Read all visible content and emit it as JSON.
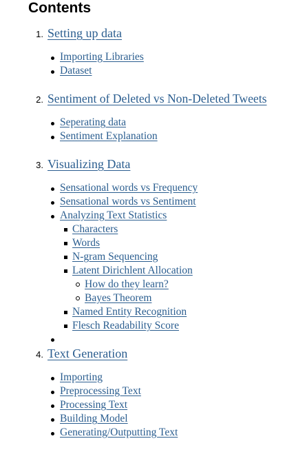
{
  "toc": {
    "title": "Contents",
    "sections": [
      {
        "number": "1.",
        "label": "Setting up data",
        "items": [
          "Importing Libraries",
          "Dataset"
        ]
      },
      {
        "number": "2.",
        "label": "Sentiment of Deleted vs Non-Deleted Tweets",
        "items": [
          "Seperating data",
          "Sentiment Explanation"
        ]
      },
      {
        "number": "3.",
        "label": "Visualizing Data",
        "items": [
          "Sensational words vs Frequency",
          "Sensational words vs Sentiment",
          "Analyzing Text Statistics"
        ],
        "text_stats": [
          "Characters",
          "Words",
          "N-gram Sequencing",
          "Latent Dirichlent Allocation",
          "Named Entity Recognition",
          "Flesch Readability Score"
        ],
        "lda": [
          "How do they learn?",
          "Bayes Theorem"
        ]
      },
      {
        "number": "4.",
        "label": "Text Generation",
        "items": [
          "Importing",
          "Preprocessing Text",
          "Processing Text",
          "Building Model",
          "Generating/Outputting Text"
        ]
      }
    ]
  }
}
